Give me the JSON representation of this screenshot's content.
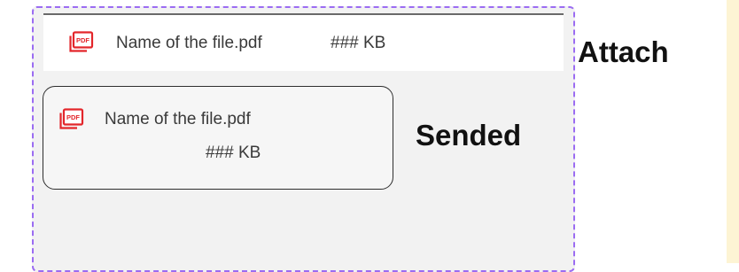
{
  "colors": {
    "frame_border": "#9b6cf2",
    "pdf_icon": "#e3262b",
    "side_strip": "#fdf4d4"
  },
  "icons": {
    "pdf": "pdf-file-icon"
  },
  "attach_variant": {
    "file_name": "Name of the file.pdf",
    "file_size": "### KB",
    "state_label": "Attach"
  },
  "sent_variant": {
    "file_name": "Name of the file.pdf",
    "file_size": "### KB",
    "state_label": "Sended"
  }
}
